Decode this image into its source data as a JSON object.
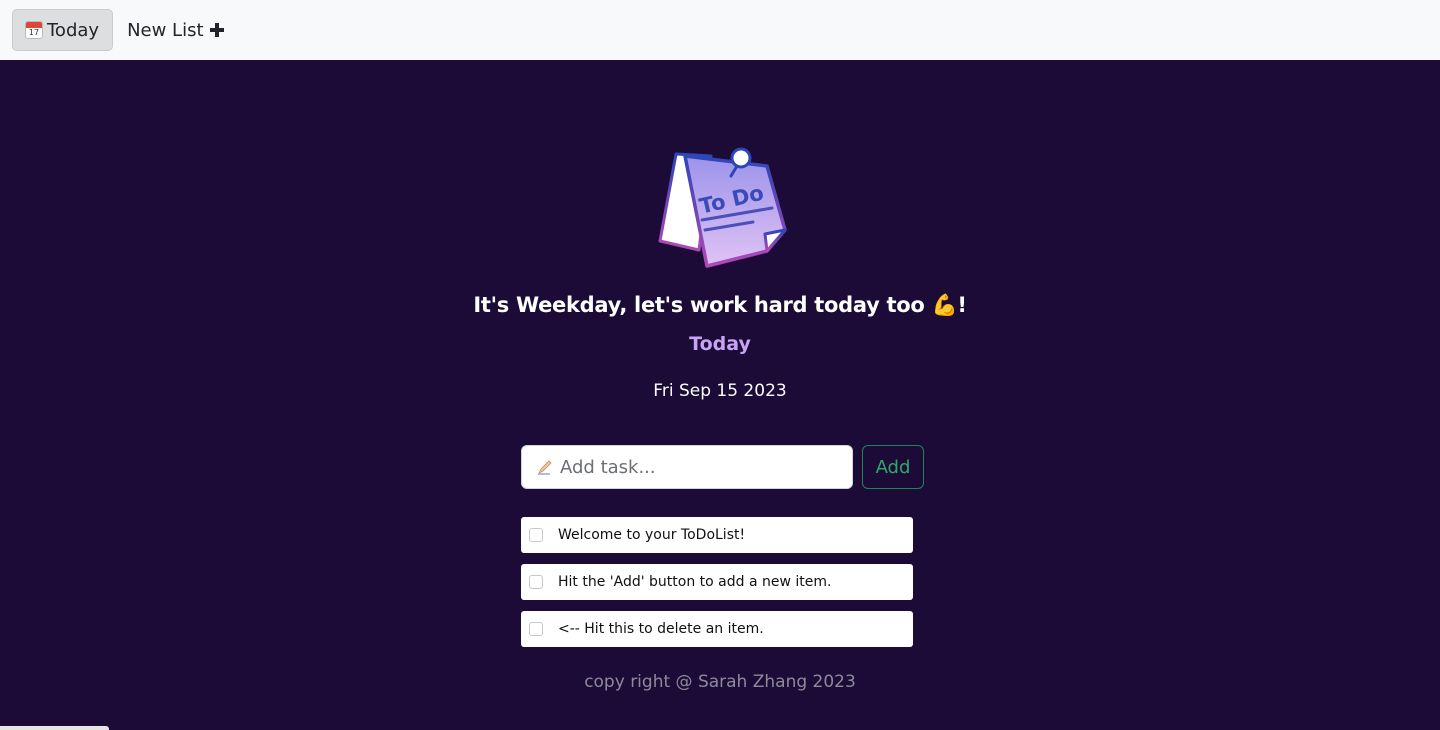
{
  "nav": {
    "today_label": "Today",
    "today_icon": "calendar-icon",
    "calendar_day": "17",
    "new_list_label": "New List",
    "new_list_icon": "plus-icon"
  },
  "hero": {
    "logo_icon": "todo-note-icon",
    "logo_text": "To Do",
    "headline": "It's Weekday, let's work hard today too 💪!",
    "list_title": "Today",
    "date": "Fri Sep 15 2023"
  },
  "add_form": {
    "placeholder": "Add task...",
    "placeholder_icon": "pencil-icon",
    "add_button_label": "Add"
  },
  "todos": [
    {
      "text": "Welcome to your ToDoList!",
      "checked": false
    },
    {
      "text": "Hit the 'Add' button to add a new item.",
      "checked": false
    },
    {
      "text": "<-- Hit this to delete an item.",
      "checked": false
    }
  ],
  "footer": {
    "text": "copy right @ Sarah Zhang 2023"
  },
  "colors": {
    "background": "#1b0b36",
    "navbar": "#f8f9fa",
    "accent_purple": "#c7a4f5",
    "add_button_green": "#198754"
  }
}
